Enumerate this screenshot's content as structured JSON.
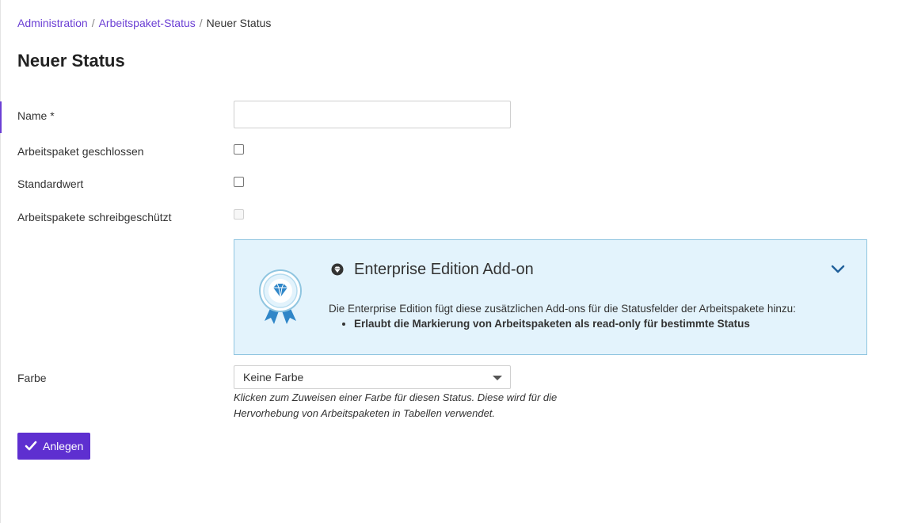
{
  "breadcrumb": {
    "items": [
      "Administration",
      "Arbeitspaket-Status"
    ],
    "separator": "/",
    "current": "Neuer Status"
  },
  "page_title": "Neuer Status",
  "form": {
    "name_label": "Name *",
    "name_value": "",
    "closed_label": "Arbeitspaket geschlossen",
    "default_label": "Standardwert",
    "readonly_label": "Arbeitspakete schreibgeschützt",
    "color_label": "Farbe",
    "color_value": "Keine Farbe",
    "color_help": "Klicken zum Zuweisen einer Farbe für diesen Status. Diese wird für die Hervorhebung von Arbeitspaketen in Tabellen verwendet.",
    "submit_label": "Anlegen"
  },
  "enterprise": {
    "title": "Enterprise Edition Add-on",
    "description": "Die Enterprise Edition fügt diese zusätzlichen Add-ons für die Statusfelder der Arbeitspakete hinzu:",
    "features": [
      "Erlaubt die Markierung von Arbeitspaketen als read-only für bestimmte Status"
    ]
  },
  "colors": {
    "accent": "#5e2fd0",
    "link": "#6b3fd4",
    "ee_background": "#e3f3fc",
    "ee_border": "#8fc5e0",
    "ee_badge": "#2f86c8"
  },
  "icons": {
    "ee_badge": "award-ribbon-icon",
    "ee_title": "enterprise-gem-icon",
    "collapse": "chevron-down-icon",
    "submit": "checkmark-icon",
    "select": "caret-down-icon"
  }
}
